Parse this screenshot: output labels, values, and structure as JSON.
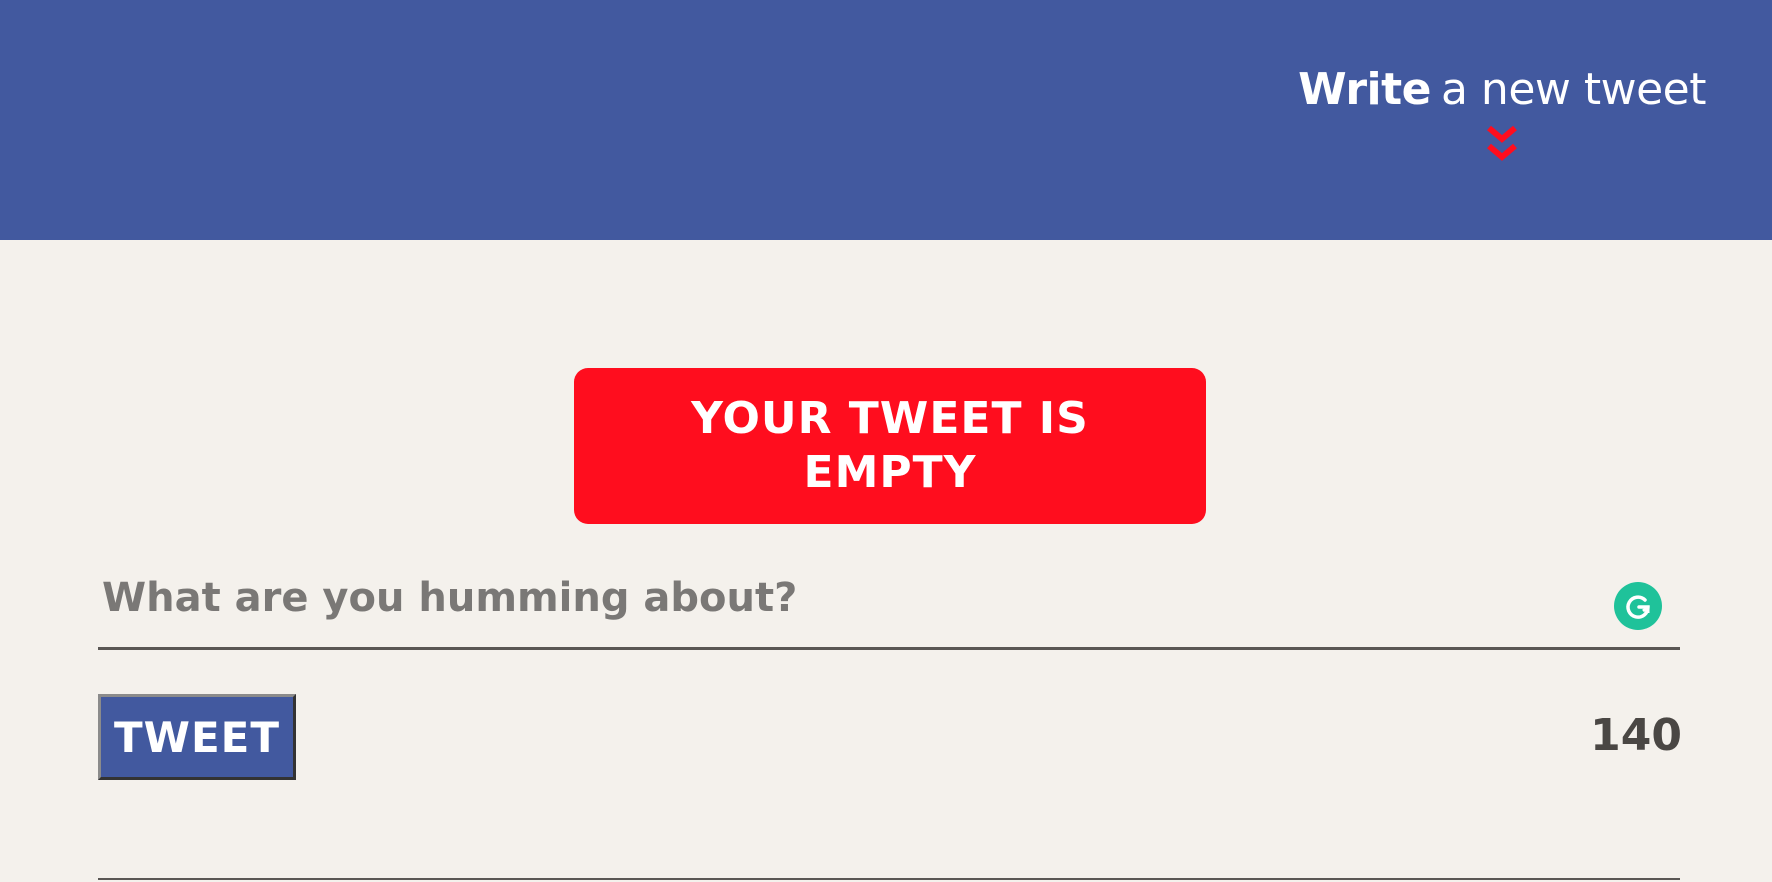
{
  "header": {
    "compose_bold": "Write",
    "compose_light": "a new tweet",
    "chevron_icon": "double-chevron-down",
    "background_color": "#42599f",
    "chevron_color": "#ff0d1e"
  },
  "alert": {
    "message": "YOUR TWEET IS EMPTY",
    "background_color": "#ff0d1e"
  },
  "composer": {
    "placeholder": "What are you humming about?",
    "value": "",
    "assistant_icon": "grammarly-icon"
  },
  "actions": {
    "tweet_label": "TWEET",
    "char_remaining": "140"
  }
}
